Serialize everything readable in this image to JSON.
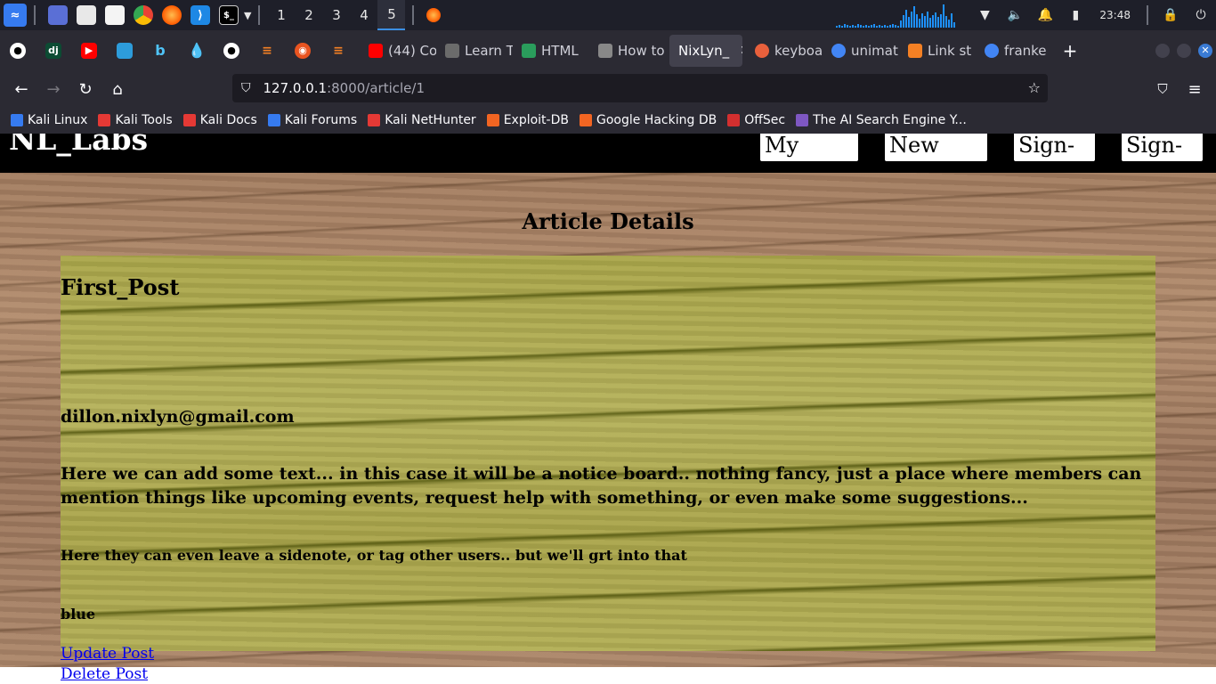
{
  "taskbar": {
    "workspaces": [
      "1",
      "2",
      "3",
      "4",
      "5"
    ],
    "active_workspace": "5",
    "clock": "23:48"
  },
  "browser": {
    "tabs": [
      {
        "label": "(44) Co",
        "color": "#ff0000"
      },
      {
        "label": "Learn T",
        "color": "#6b6b6b"
      },
      {
        "label": "HTML",
        "color": "#2a9d5c"
      },
      {
        "label": "How to",
        "color": "#888888"
      },
      {
        "label": "NixLyn_",
        "color": "",
        "active": true
      },
      {
        "label": "keyboa",
        "color": "#e8603c"
      },
      {
        "label": "unimat",
        "color": "#4285f4"
      },
      {
        "label": "Link st",
        "color": "#f48024"
      },
      {
        "label": "franke",
        "color": "#4285f4"
      }
    ],
    "url": {
      "host": "127.0.0.1",
      "path": ":8000/article/1"
    },
    "bookmarks": [
      {
        "label": "Kali Linux",
        "color": "#367bf0"
      },
      {
        "label": "Kali Tools",
        "color": "#e53935"
      },
      {
        "label": "Kali Docs",
        "color": "#e53935"
      },
      {
        "label": "Kali Forums",
        "color": "#367bf0"
      },
      {
        "label": "Kali NetHunter",
        "color": "#e53935"
      },
      {
        "label": "Exploit-DB",
        "color": "#f26522"
      },
      {
        "label": "Google Hacking DB",
        "color": "#f26522"
      },
      {
        "label": "OffSec",
        "color": "#d32f2f"
      },
      {
        "label": "The AI Search Engine Y...",
        "color": "#7e57c2"
      }
    ]
  },
  "site": {
    "brand": "NL_Labs",
    "nav": [
      "My Dash",
      "New Post",
      "Sign-In",
      "Sign-In"
    ],
    "page_heading": "Article Details",
    "post": {
      "title": "First_Post",
      "author": "dillon.nixlyn@gmail.com",
      "body": "Here we can add some text... in this case it will be a notice board.. nothing fancy, just a place where members can mention things like upcoming events, request help with something, or even make some suggestions...",
      "note": "Here they can even leave a sidenote, or tag other users.. but we'll grt into that",
      "tag": "blue"
    },
    "actions": {
      "update": "Update Post",
      "delete": "Delete Post"
    }
  }
}
